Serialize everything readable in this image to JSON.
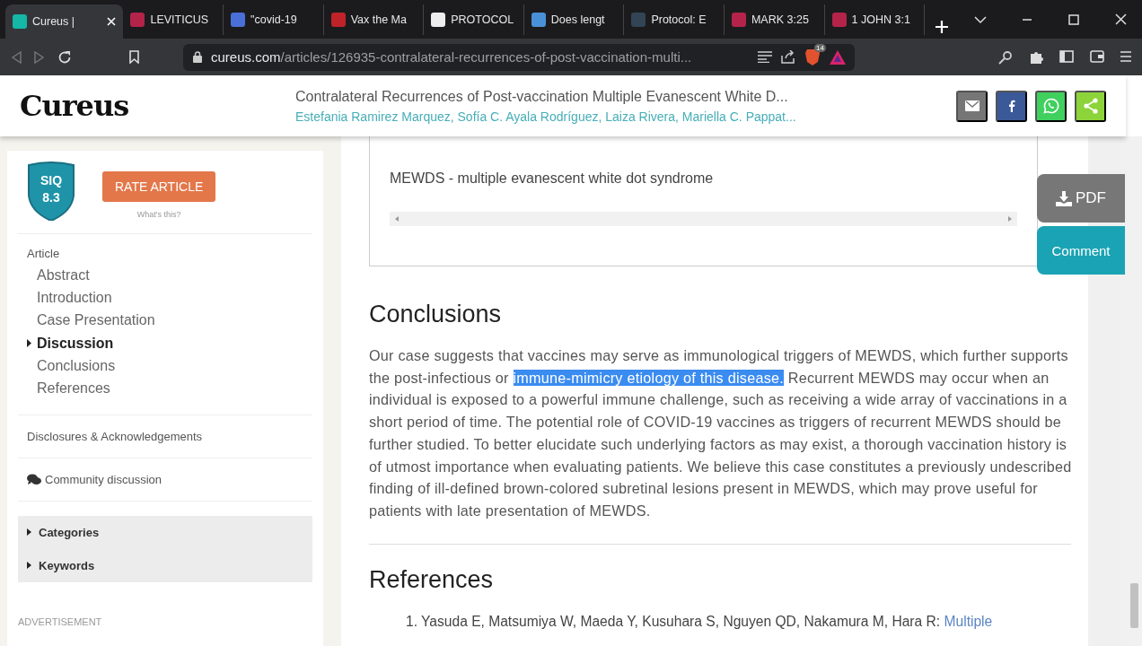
{
  "browser": {
    "tabs": [
      {
        "label": "Cureus |",
        "selected": true
      },
      {
        "label": "LEVITICUS",
        "selected": false
      },
      {
        "label": "\"covid-19",
        "selected": false
      },
      {
        "label": "Vax the Ma",
        "selected": false
      },
      {
        "label": "PROTOCOL",
        "selected": false
      },
      {
        "label": "Does lengt",
        "selected": false
      },
      {
        "label": "Protocol: E",
        "selected": false
      },
      {
        "label": "MARK 3:25",
        "selected": false
      },
      {
        "label": "1 JOHN 3:1",
        "selected": false
      }
    ],
    "address": {
      "domain": "cureus.com",
      "path": "/articles/126935-contralateral-recurrences-of-post-vaccination-multi..."
    },
    "shield_badge": "14"
  },
  "header": {
    "logo": "Cureus",
    "title": "Contralateral Recurrences of Post-vaccination Multiple Evanescent White D...",
    "authors": "Estefania Ramirez Marquez, Sofía C. Ayala Rodríguez, Laiza Rivera, Mariella C. Pappat...",
    "share_buttons": [
      {
        "kind": "email",
        "color": "#767676"
      },
      {
        "kind": "facebook",
        "color": "#3b5998"
      },
      {
        "kind": "whatsapp",
        "color": "#3fd05e"
      },
      {
        "kind": "share",
        "color": "#8cd43a"
      }
    ]
  },
  "sidebar": {
    "siq": {
      "label": "SIQ",
      "score": "8.3"
    },
    "rate_button": "RATE ARTICLE",
    "whats_this": "What's this?",
    "section_label": "Article",
    "nav": [
      {
        "label": "Abstract",
        "selected": false
      },
      {
        "label": "Introduction",
        "selected": false
      },
      {
        "label": "Case Presentation",
        "selected": false
      },
      {
        "label": "Discussion",
        "selected": true
      },
      {
        "label": "Conclusions",
        "selected": false
      },
      {
        "label": "References",
        "selected": false
      }
    ],
    "disclosures": "Disclosures & Acknowledgements",
    "community": "Community discussion",
    "collapsibles": [
      {
        "label": "Categories",
        "expanded": false
      },
      {
        "label": "Keywords",
        "expanded": false
      }
    ],
    "advertisement": "ADVERTISEMENT"
  },
  "content": {
    "table_note": "MEWDS - multiple evanescent white dot syndrome",
    "conclusions": {
      "heading": "Conclusions",
      "parts": [
        {
          "text": "Our case suggests that vaccines may serve as immunological triggers of MEWDS, which further supports the post-infectious or ",
          "highlighted": false
        },
        {
          "text": "immune-mimicry etiology of this disease.",
          "highlighted": true
        },
        {
          "text": " Recurrent MEWDS may occur when an individual is exposed to a powerful immune challenge, such as receiving a wide array of vaccinations in a short period of time. The potential role of COVID-19 vaccines as triggers of recurrent MEWDS should be further studied. To better elucidate such underlying factors as may exist, a thorough vaccination history is of utmost importance when evaluating patients. We believe this case constitutes a previously undescribed finding of ill-defined brown-colored subretinal lesions present in MEWDS, which may prove useful for patients with late presentation of MEWDS.",
          "highlighted": false
        }
      ]
    },
    "references": {
      "heading": "References",
      "items": [
        {
          "number": "1.",
          "authors": "Yasuda E, Matsumiya W, Maeda Y, Kusuhara S, Nguyen QD, Nakamura M, Hara R:",
          "link": "Multiple"
        }
      ]
    }
  },
  "floating": {
    "pdf": "PDF",
    "comment": "Comment"
  }
}
